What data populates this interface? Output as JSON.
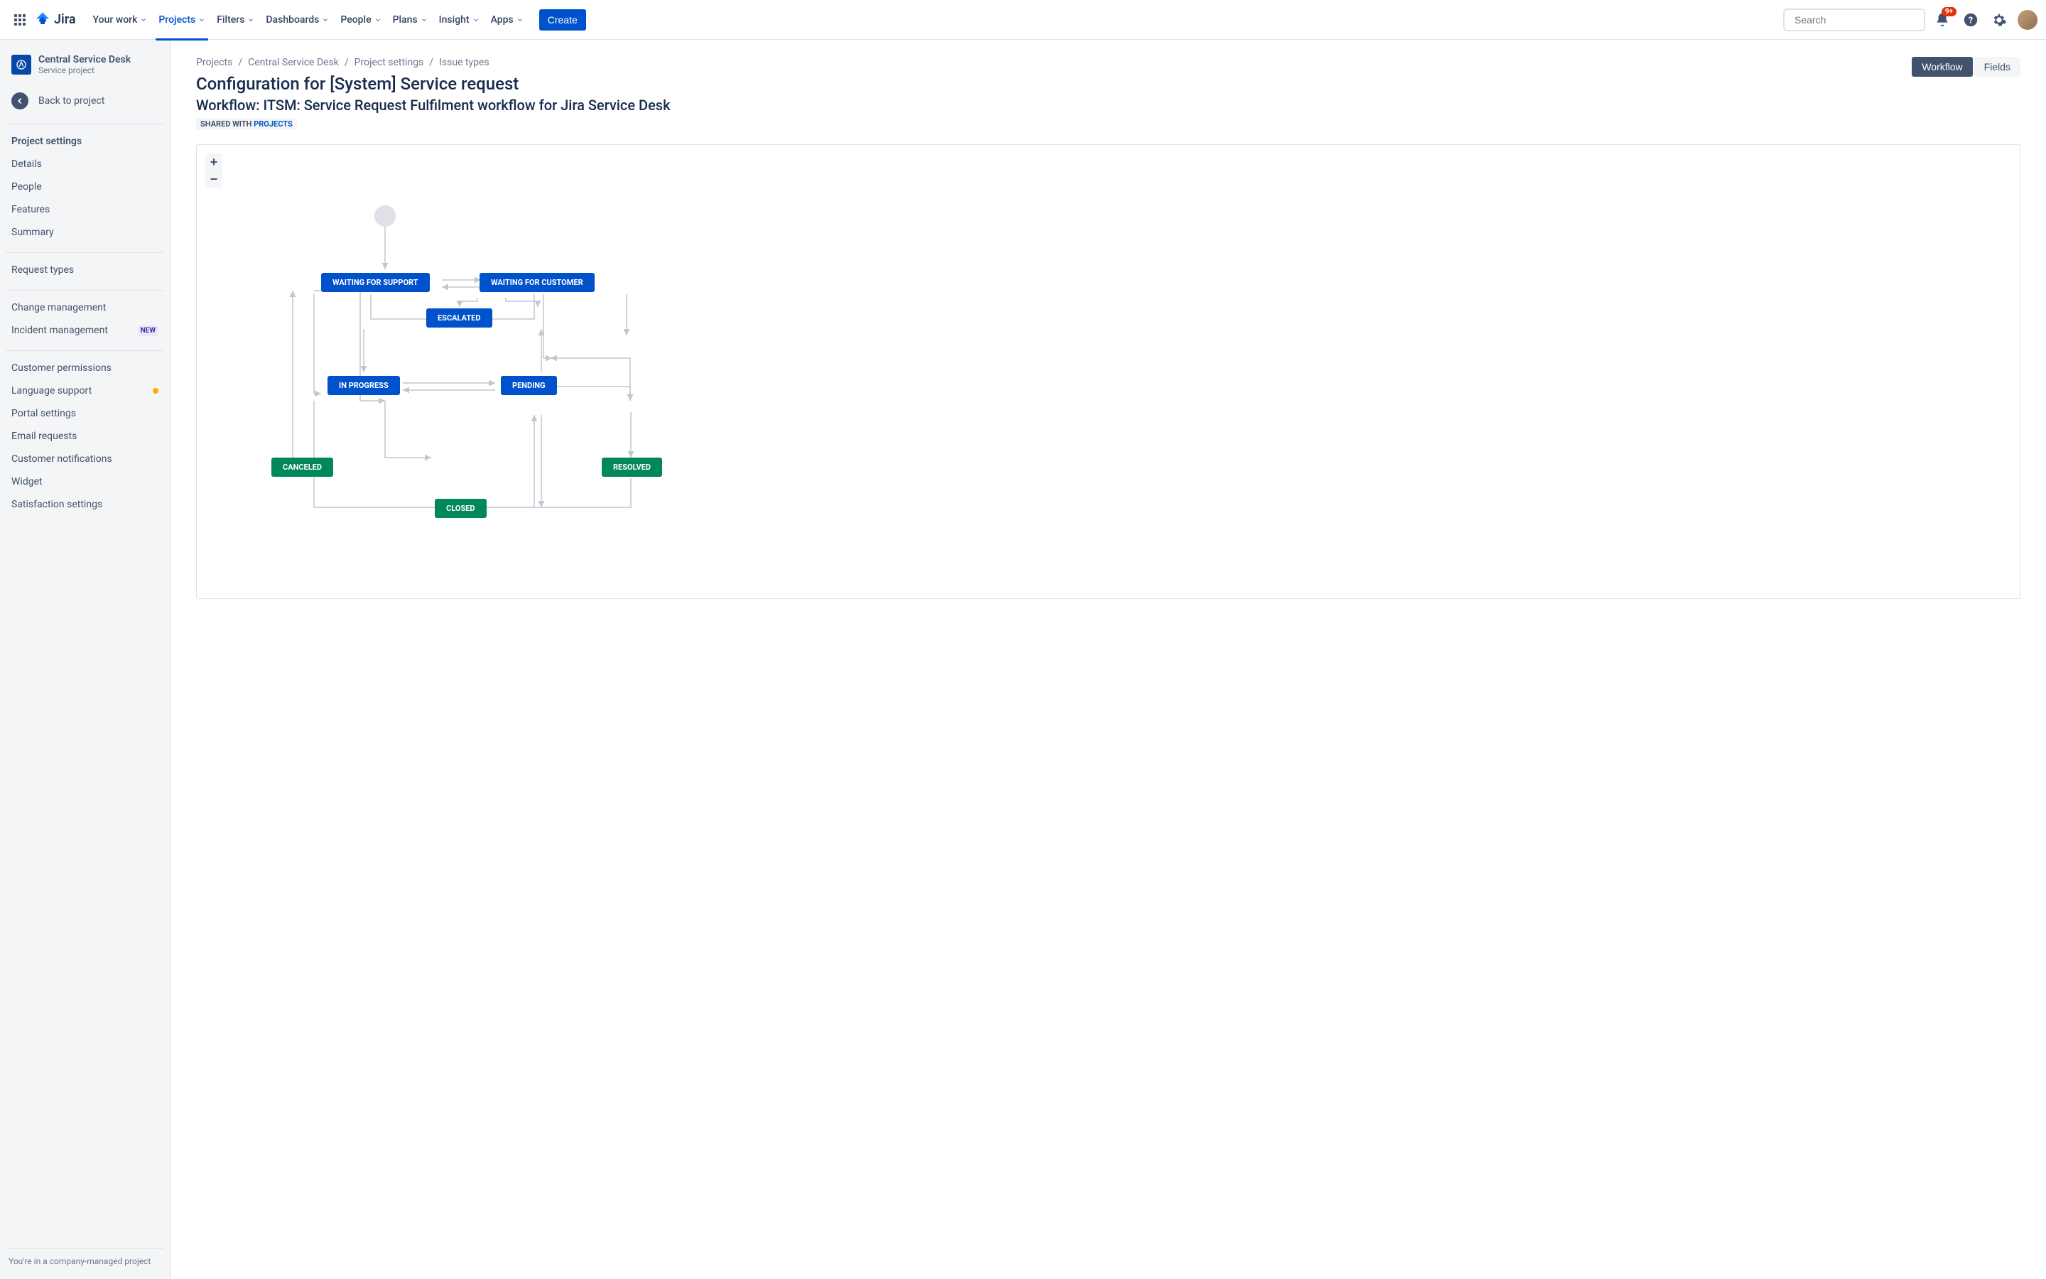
{
  "nav": {
    "items": [
      "Your work",
      "Projects",
      "Filters",
      "Dashboards",
      "People",
      "Plans",
      "Insight",
      "Apps"
    ],
    "create": "Create",
    "search_placeholder": "Search",
    "notif_badge": "9+"
  },
  "logo": {
    "text": "Jira"
  },
  "sidebar": {
    "project_name": "Central Service Desk",
    "project_sub": "Service project",
    "back": "Back to project",
    "heading": "Project settings",
    "items1": [
      "Details",
      "People",
      "Features",
      "Summary"
    ],
    "req_types": "Request types",
    "items2": [
      "Change management",
      "Incident management"
    ],
    "new_badge": "NEW",
    "items3": [
      "Customer permissions",
      "Language support",
      "Portal settings",
      "Email requests",
      "Customer notifications",
      "Widget",
      "Satisfaction settings"
    ],
    "footer": "You're in a company-managed project"
  },
  "breadcrumb": [
    "Projects",
    "Central Service Desk",
    "Project settings",
    "Issue types"
  ],
  "page": {
    "title": "Configuration for [System] Service request",
    "workflow_prefix": "Workflow: ",
    "workflow_name": "ITSM: Service Request Fulfilment workflow for Jira Service Desk",
    "shared_prefix": "SHARED WITH ",
    "shared_link": "PROJECTS",
    "tabs": {
      "workflow": "Workflow",
      "fields": "Fields"
    }
  },
  "workflow": {
    "zoom_in": "+",
    "zoom_out": "−",
    "nodes": {
      "waiting_support": "WAITING FOR SUPPORT",
      "waiting_customer": "WAITING FOR CUSTOMER",
      "escalated": "ESCALATED",
      "in_progress": "IN PROGRESS",
      "pending": "PENDING",
      "canceled": "CANCELED",
      "resolved": "RESOLVED",
      "closed": "CLOSED"
    }
  }
}
